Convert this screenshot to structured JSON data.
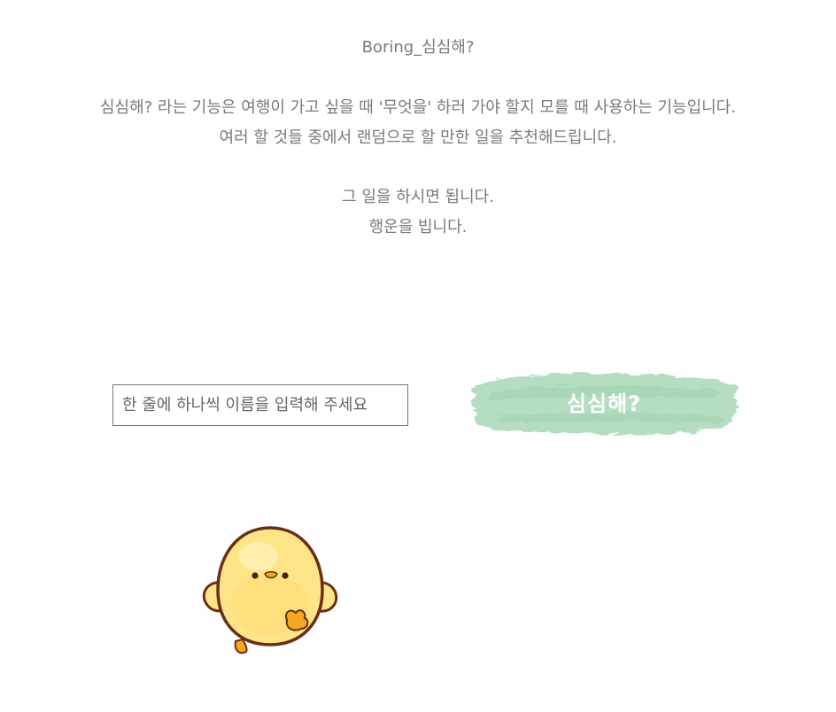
{
  "header": {
    "title": "Boring_심심해?"
  },
  "intro": {
    "line1": "심심해? 라는 기능은 여행이 가고 싶을 때 '무엇을' 하러 가야 할지 모를 때 사용하는 기능입니다.",
    "line2": "여러 할 것들 중에서 랜덤으로 할 만한 일을 추천해드립니다.",
    "line3": "그 일을 하시면 됩니다.",
    "line4": "행운을 빕니다."
  },
  "form": {
    "input_placeholder": "한 줄에 하나씩 이름을 입력해 주세요",
    "input_value": "",
    "submit_label": "심심해?"
  },
  "colors": {
    "text": "#7a7a7a",
    "brush_green": "#a8d5b5",
    "chick_yellow": "#ffe58a",
    "chick_outline": "#6b2e12",
    "chick_orange": "#f5a623"
  },
  "icons": {
    "mascot": "chick-icon"
  }
}
